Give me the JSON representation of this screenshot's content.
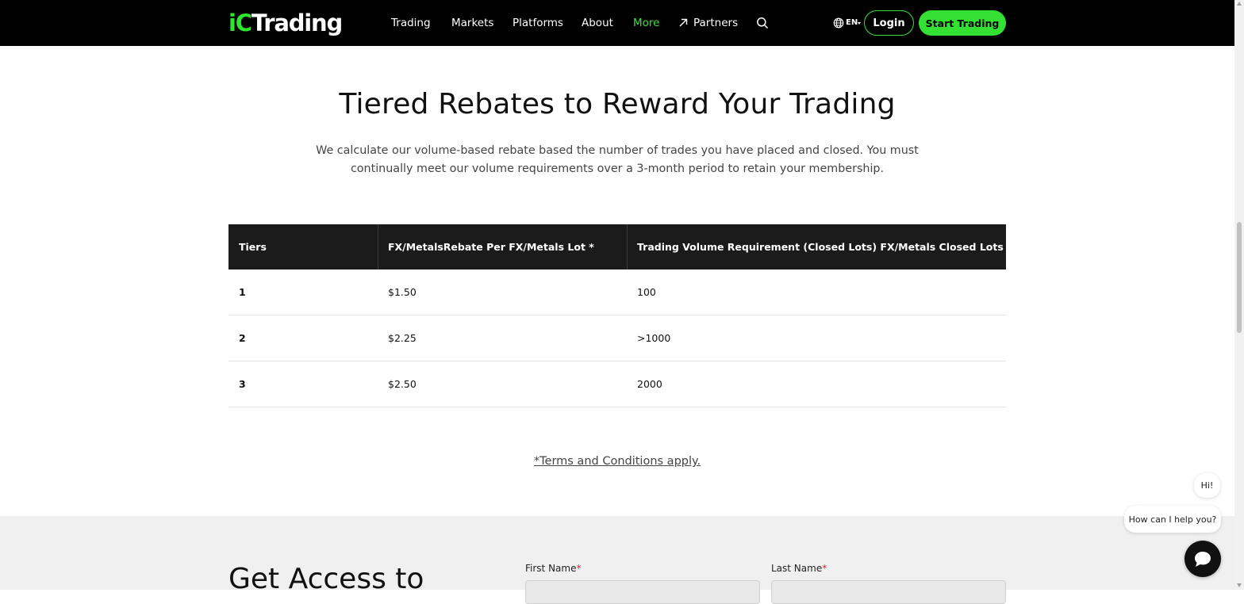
{
  "nav": {
    "logo": {
      "ic": "iC",
      "trading": "Trading"
    },
    "items": [
      {
        "label": "Trading"
      },
      {
        "label": "Markets"
      },
      {
        "label": "Platforms"
      },
      {
        "label": "About"
      },
      {
        "label": "More",
        "active": true
      },
      {
        "label": "Partners"
      }
    ],
    "language": "EN",
    "login_label": "Login",
    "start_label": "Start Trading"
  },
  "section": {
    "title": "Tiered Rebates to Reward Your Trading",
    "description": "We calculate our volume-based rebate based the number of trades you have placed and closed. You must continually meet our volume requirements over a 3-month period to retain your membership."
  },
  "table": {
    "headers": [
      "Tiers",
      "FX/MetalsRebate Per FX/Metals Lot *",
      "Trading Volume Requirement (Closed Lots) FX/Metals Closed Lots"
    ],
    "rows": [
      [
        "1",
        "$1.50",
        "100"
      ],
      [
        "2",
        "$2.25",
        ">1000"
      ],
      [
        "3",
        "$2.50",
        "2000"
      ]
    ]
  },
  "terms": "*Terms and Conditions apply.",
  "form": {
    "title": "Get Access to",
    "first_name_label": "First Name",
    "last_name_label": "Last Name",
    "required_mark": "*"
  },
  "chat": {
    "hi": "Hi!",
    "help": "How can I help you?"
  },
  "colors": {
    "brand_green": "#35e035",
    "nav_bg": "#000000",
    "table_header_bg": "#1b1b1b"
  }
}
